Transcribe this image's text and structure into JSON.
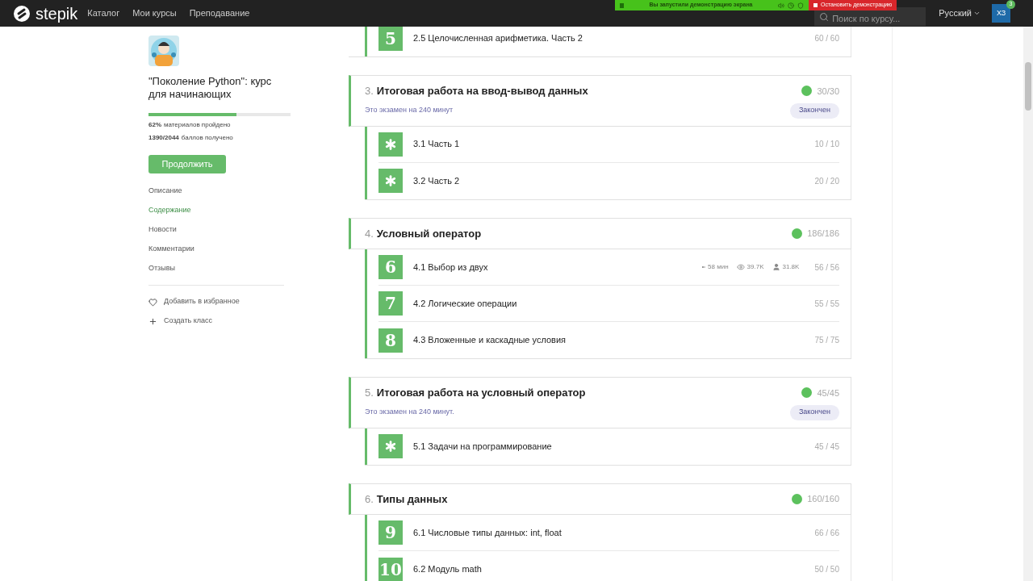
{
  "header": {
    "logo": "stepik",
    "nav": [
      "Каталог",
      "Мои курсы",
      "Преподавание"
    ],
    "demo_banner": {
      "text": "Вы запустили демонстрацию экрана",
      "stop": "Остановить демонстрацию"
    },
    "search": {
      "placeholder": "Поиск по курсу..."
    },
    "language": "Русский",
    "avatar": {
      "initials": "ХЗ",
      "badge": "3"
    }
  },
  "sidebar": {
    "course_title": "\"Поколение Python\": курс для начинающих",
    "progress": {
      "level": 0.62
    },
    "materials": {
      "value": "62%",
      "label": "материалов пройдено"
    },
    "points": {
      "value": "1390/2044",
      "label": "баллов получено"
    },
    "continue_button": "Продолжить",
    "menu": [
      {
        "label": "Описание",
        "selected": false
      },
      {
        "label": "Содержание",
        "selected": true
      },
      {
        "label": "Новости",
        "selected": false
      },
      {
        "label": "Комментарии",
        "selected": false
      },
      {
        "label": "Отзывы",
        "selected": false
      }
    ],
    "actions": [
      "Добавить в избранное",
      "Создать класс"
    ]
  },
  "top_lessons": [
    {
      "kind": "number",
      "badge": "5",
      "title": "2.5 Целочисленная арифметика. Часть 2",
      "score": "60 / 60"
    }
  ],
  "sections": [
    {
      "number": "3.",
      "title": "Итоговая работа на ввод-вывод данных",
      "completed": true,
      "score": "30/30",
      "exam_note": "Это экзамен на 240 минут",
      "status": "Закончен",
      "lessons": [
        {
          "kind": "exam",
          "title": "3.1 Часть 1",
          "score": "10 / 10"
        },
        {
          "kind": "exam",
          "title": "3.2 Часть 2",
          "score": "20 / 20"
        }
      ]
    },
    {
      "number": "4.",
      "title": "Условный оператор",
      "completed": true,
      "score": "186/186",
      "lessons": [
        {
          "kind": "number",
          "badge": "6",
          "title": "4.1 Выбор из двух",
          "score": "56 / 56",
          "meta": {
            "time": "58 мин",
            "views": "39.7K",
            "learners": "31.8K"
          }
        },
        {
          "kind": "number",
          "badge": "7",
          "title": "4.2 Логические операции",
          "score": "55 / 55"
        },
        {
          "kind": "number",
          "badge": "8",
          "title": "4.3 Вложенные и каскадные условия",
          "score": "75 / 75"
        }
      ]
    },
    {
      "number": "5.",
      "title": "Итоговая работа на условный оператор",
      "completed": true,
      "score": "45/45",
      "exam_note": "Это экзамен на 240 минут.",
      "status": "Закончен",
      "lessons": [
        {
          "kind": "exam",
          "title": "5.1 Задачи на программирование",
          "score": "45 / 45"
        }
      ]
    },
    {
      "number": "6.",
      "title": "Типы данных",
      "completed": true,
      "score": "160/160",
      "lessons": [
        {
          "kind": "number",
          "badge": "9",
          "title": "6.1 Числовые типы данных: int, float",
          "score": "66 / 66"
        },
        {
          "kind": "number",
          "badge": "10",
          "title": "6.2 Модуль math",
          "score": "50 / 50"
        }
      ]
    }
  ]
}
